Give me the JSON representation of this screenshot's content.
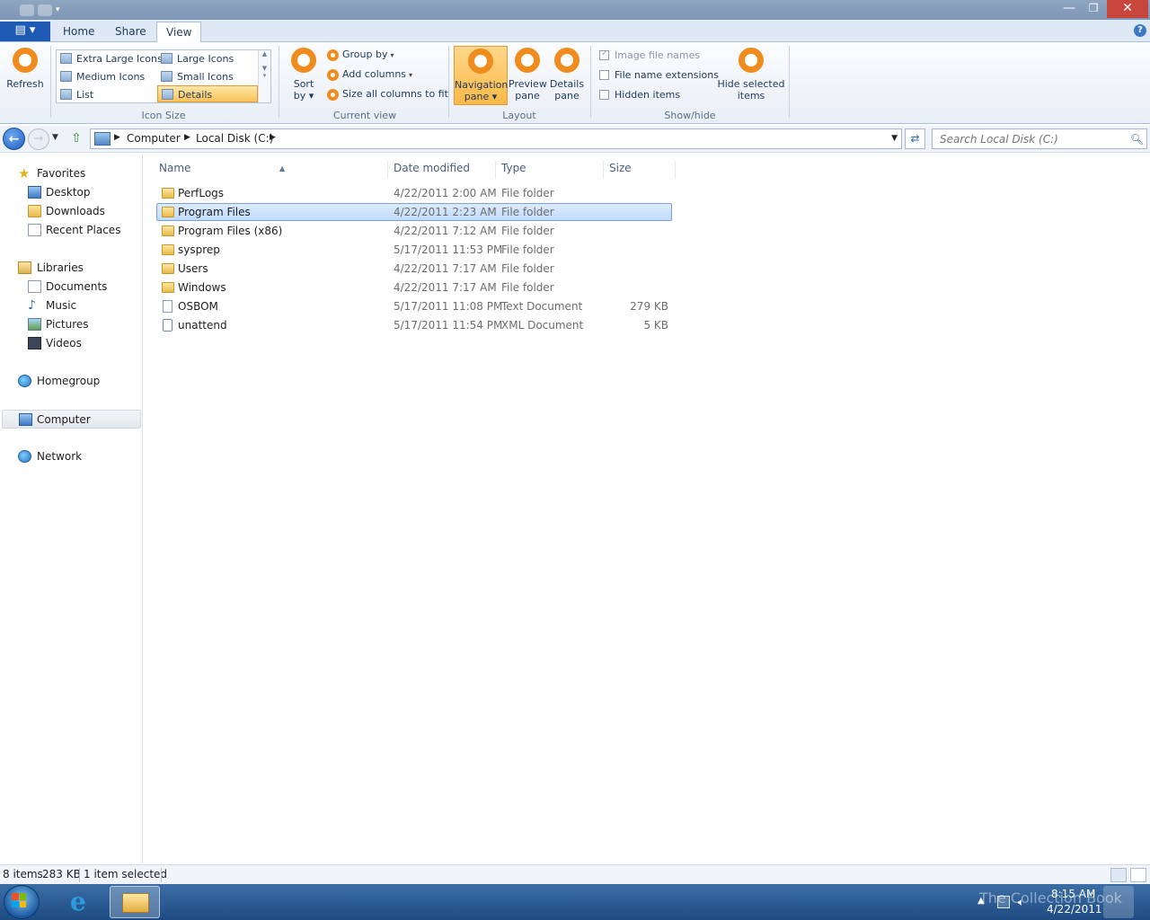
{
  "ribbon": {
    "tabs": {
      "home": "Home",
      "share": "Share",
      "view": "View"
    },
    "refresh": "Refresh",
    "layout_items": {
      "extra_large": "Extra Large Icons",
      "large": "Large Icons",
      "medium": "Medium Icons",
      "small": "Small Icons",
      "list": "List",
      "details": "Details"
    },
    "icon_size_label": "Icon Size",
    "sort_by_1": "Sort",
    "sort_by_2": "by",
    "group_by": "Group by",
    "add_columns": "Add columns",
    "size_all_columns": "Size all columns to fit",
    "current_view_label": "Current view",
    "navigation_pane_1": "Navigation",
    "navigation_pane_2": "pane",
    "preview_pane_1": "Preview",
    "preview_pane_2": "pane",
    "details_pane_1": "Details",
    "details_pane_2": "pane",
    "layout_label": "Layout",
    "image_file_names": "Image file names",
    "file_name_extensions": "File name extensions",
    "hidden_items": "Hidden items",
    "hide_selected_1": "Hide selected",
    "hide_selected_2": "items",
    "show_hide_label": "Show/hide"
  },
  "address": {
    "crumbs": [
      "Computer",
      "Local Disk (C:)"
    ],
    "search_placeholder": "Search Local Disk (C:)"
  },
  "nav": {
    "favorites": "Favorites",
    "desktop": "Desktop",
    "downloads": "Downloads",
    "recent_places": "Recent Places",
    "libraries": "Libraries",
    "documents": "Documents",
    "music": "Music",
    "pictures": "Pictures",
    "videos": "Videos",
    "homegroup": "Homegroup",
    "computer": "Computer",
    "network": "Network"
  },
  "columns": {
    "name": "Name",
    "date": "Date modified",
    "type": "Type",
    "size": "Size"
  },
  "files": [
    {
      "name": "PerfLogs",
      "date": "4/22/2011 2:00 AM",
      "type": "File folder",
      "size": ""
    },
    {
      "name": "Program Files",
      "date": "4/22/2011 2:23 AM",
      "type": "File folder",
      "size": ""
    },
    {
      "name": "Program Files (x86)",
      "date": "4/22/2011 7:12 AM",
      "type": "File folder",
      "size": ""
    },
    {
      "name": "sysprep",
      "date": "5/17/2011 11:53 PM",
      "type": "File folder",
      "size": ""
    },
    {
      "name": "Users",
      "date": "4/22/2011 7:17 AM",
      "type": "File folder",
      "size": ""
    },
    {
      "name": "Windows",
      "date": "4/22/2011 7:17 AM",
      "type": "File folder",
      "size": ""
    },
    {
      "name": "OSBOM",
      "date": "5/17/2011 11:08 PM",
      "type": "Text Document",
      "size": "279 KB"
    },
    {
      "name": "unattend",
      "date": "5/17/2011 11:54 PM",
      "type": "XML Document",
      "size": "5 KB"
    }
  ],
  "status": {
    "items": "8 items",
    "size": "283 KB",
    "selected": "1 item selected"
  },
  "taskbar": {
    "time": "8:15 AM",
    "date": "4/22/2011",
    "watermark": "The Collection Book"
  },
  "colors": {
    "accent": "#f08c1e",
    "selection": "#c1dbfc",
    "taskbar": "#1d4b82"
  }
}
